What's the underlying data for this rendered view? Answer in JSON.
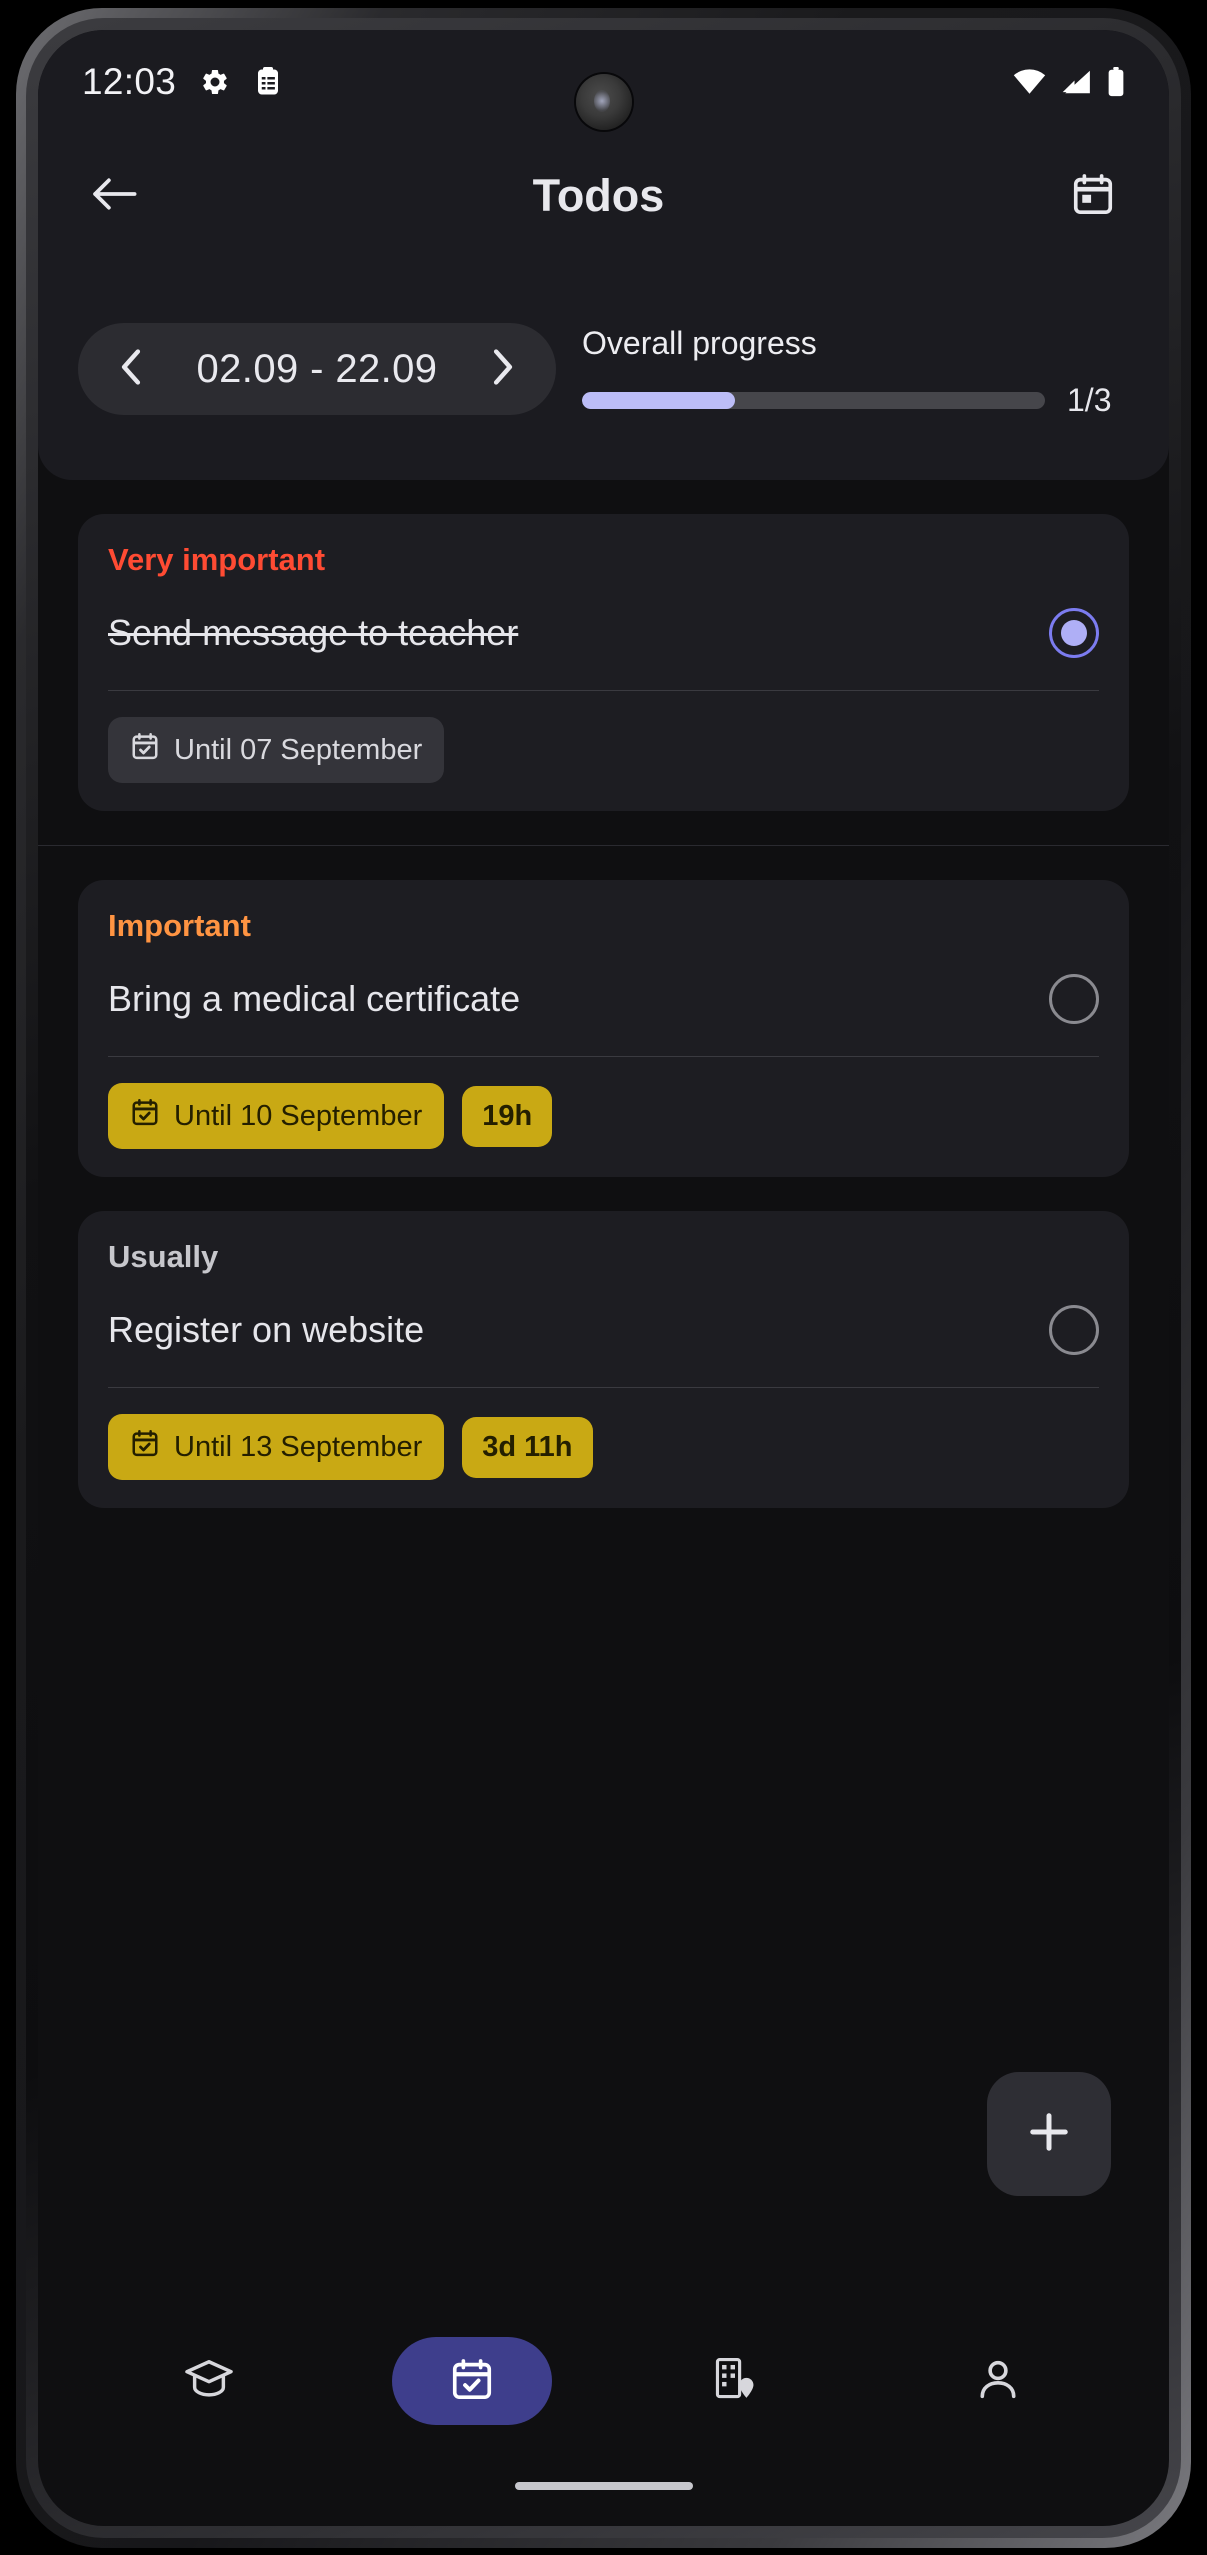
{
  "statusbar": {
    "time": "12:03",
    "left_icons": [
      "gear-icon",
      "clipboard-list-icon"
    ],
    "right_icons": [
      "wifi-icon",
      "cellular-signal-icon",
      "battery-icon"
    ]
  },
  "header": {
    "back_icon": "arrow-left-icon",
    "title": "Todos",
    "calendar_icon": "calendar-icon"
  },
  "date_selector": {
    "prev_icon": "chevron-left-icon",
    "range": "02.09 - 22.09",
    "next_icon": "chevron-right-icon"
  },
  "progress": {
    "title": "Overall progress",
    "count": "1/3",
    "percent": 33,
    "fill_color": "#BCBDF7",
    "track_color": "#46464B"
  },
  "task_groups": [
    {
      "category": "Very important",
      "category_color": "#FF4B33",
      "task": "Send message to teacher",
      "completed": true,
      "due_chip": {
        "icon": "calendar-check-icon",
        "label": "Until 07 September",
        "style": "neutral"
      },
      "time_badge": null
    },
    {
      "category": "Important",
      "category_color": "#FF9442",
      "task": "Bring a medical certificate",
      "completed": false,
      "due_chip": {
        "icon": "calendar-check-icon",
        "label": "Until 10 September",
        "style": "warn"
      },
      "time_badge": "19h"
    },
    {
      "category": "Usually",
      "category_color": "#C7C7CC",
      "task": "Register on website",
      "completed": false,
      "due_chip": {
        "icon": "calendar-check-icon",
        "label": "Until 13 September",
        "style": "warn"
      },
      "time_badge": "3d 11h"
    }
  ],
  "fab": {
    "icon": "plus-icon",
    "label": "+"
  },
  "bottom_nav": [
    {
      "icon": "graduation-cap-icon",
      "name": "study",
      "active": false
    },
    {
      "icon": "calendar-check-icon",
      "name": "todos",
      "active": true
    },
    {
      "icon": "building-location-icon",
      "name": "campus",
      "active": false
    },
    {
      "icon": "person-icon",
      "name": "profile",
      "active": false
    }
  ],
  "colors": {
    "screen_bg": "#0F0F11",
    "panel_bg": "#1B1B20",
    "card_bg": "#1D1D22",
    "accent_purple": "#3E3E8C",
    "chip_yellow": "#C9A914"
  }
}
